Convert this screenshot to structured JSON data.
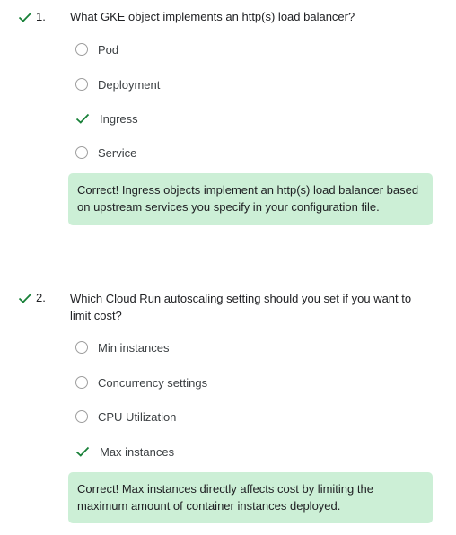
{
  "colors": {
    "correct_check": "#188038",
    "feedback_bg": "#ccefd6",
    "radio_border": "#9e9e9e"
  },
  "questions": [
    {
      "number": "1.",
      "status_icon": "check-icon",
      "text": "What GKE object implements an http(s) load balancer?",
      "options": [
        {
          "label": "Pod",
          "selected": false
        },
        {
          "label": "Deployment",
          "selected": false
        },
        {
          "label": "Ingress",
          "selected": true
        },
        {
          "label": "Service",
          "selected": false
        }
      ],
      "feedback": "Correct! Ingress objects implement an http(s) load balancer based on upstream services you specify in your configuration file."
    },
    {
      "number": "2.",
      "status_icon": "check-icon",
      "text": "Which Cloud Run autoscaling setting should you set if you want to limit cost?",
      "options": [
        {
          "label": "Min instances",
          "selected": false
        },
        {
          "label": "Concurrency settings",
          "selected": false
        },
        {
          "label": "CPU Utilization",
          "selected": false
        },
        {
          "label": "Max instances",
          "selected": true
        }
      ],
      "feedback": "Correct! Max instances directly affects cost by limiting the maximum amount of container instances deployed."
    }
  ]
}
